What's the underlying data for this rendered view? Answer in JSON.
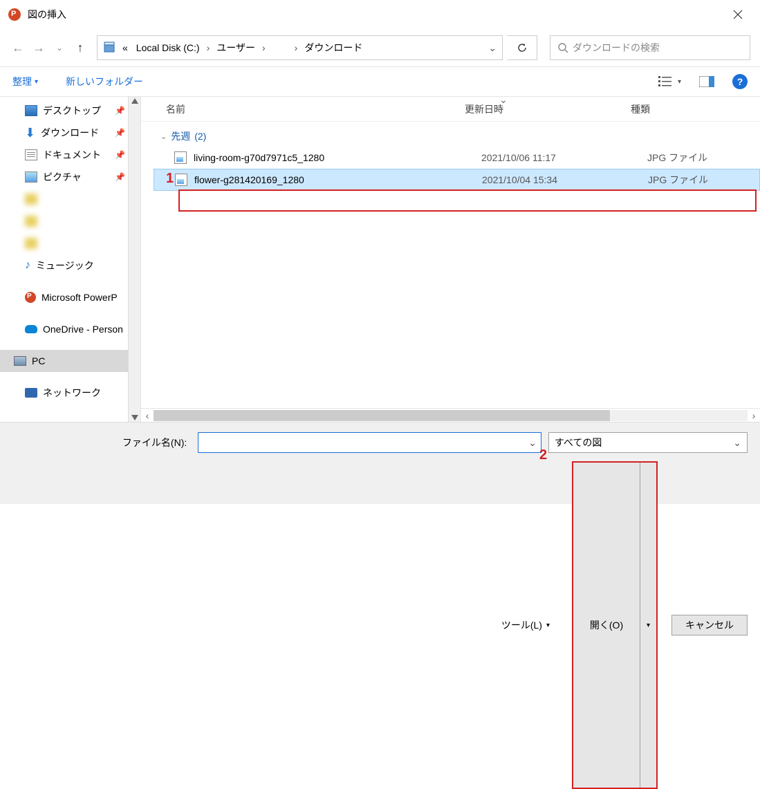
{
  "title": "図の挿入",
  "breadcrumb": {
    "prefix": "«",
    "parts": [
      "Local Disk (C:)",
      "ユーザー",
      "",
      "ダウンロード"
    ]
  },
  "search_placeholder": "ダウンロードの検索",
  "toolbar": {
    "organize": "整理",
    "newfolder": "新しいフォルダー"
  },
  "sidebar": [
    {
      "label": "デスクトップ",
      "icon": "desktop",
      "pin": true
    },
    {
      "label": "ダウンロード",
      "icon": "download",
      "pin": true
    },
    {
      "label": "ドキュメント",
      "icon": "doc",
      "pin": true
    },
    {
      "label": "ピクチャ",
      "icon": "pic",
      "pin": true
    },
    {
      "label": "",
      "icon": "blur",
      "blur": true
    },
    {
      "label": "",
      "icon": "blur",
      "blur": true
    },
    {
      "label": "",
      "icon": "blur",
      "blur": true
    },
    {
      "label": "ミュージック",
      "icon": "music"
    },
    {
      "label": "Microsoft PowerP",
      "icon": "pp",
      "spacer_before": true
    },
    {
      "label": "OneDrive - Person",
      "icon": "od",
      "spacer_before": true
    },
    {
      "label": "PC",
      "icon": "pcmon",
      "spacer_before": true,
      "selected": true
    },
    {
      "label": "ネットワーク",
      "icon": "netw",
      "spacer_before": true
    }
  ],
  "columns": {
    "name": "名前",
    "date": "更新日時",
    "type": "種類"
  },
  "group": {
    "label": "先週",
    "count": "(2)"
  },
  "files": [
    {
      "name": "living-room-g70d7971c5_1280",
      "date": "2021/10/06 11:17",
      "type": "JPG ファイル",
      "selected": false
    },
    {
      "name": "flower-g281420169_1280",
      "date": "2021/10/04 15:34",
      "type": "JPG ファイル",
      "selected": true
    }
  ],
  "bottom": {
    "filename_label": "ファイル名(N):",
    "filename_value": "",
    "filetype": "すべての図",
    "tools": "ツール(L)",
    "open": "開く(O)",
    "cancel": "キャンセル"
  },
  "annotations": {
    "a1": "1",
    "a2": "2"
  }
}
